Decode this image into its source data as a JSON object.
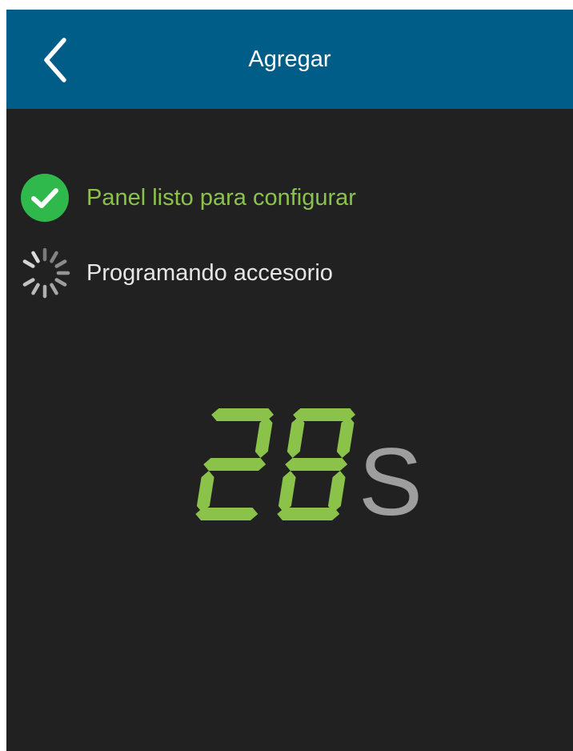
{
  "header": {
    "title": "Agregar",
    "back_icon": "chevron-left-icon",
    "background": "#005d88"
  },
  "status": {
    "items": [
      {
        "label": "Panel listo para configurar",
        "state": "done",
        "icon": "check-circle-icon",
        "color": "#8bc34a"
      },
      {
        "label": "Programando accesorio",
        "state": "in-progress",
        "icon": "spinner-icon",
        "color": "#e6e6e6"
      }
    ]
  },
  "countdown": {
    "value": "28",
    "unit": "S",
    "digit_color": "#8bc34a",
    "unit_color": "#9e9e9e"
  },
  "colors": {
    "background": "#212121",
    "accent": "#8bc34a"
  }
}
